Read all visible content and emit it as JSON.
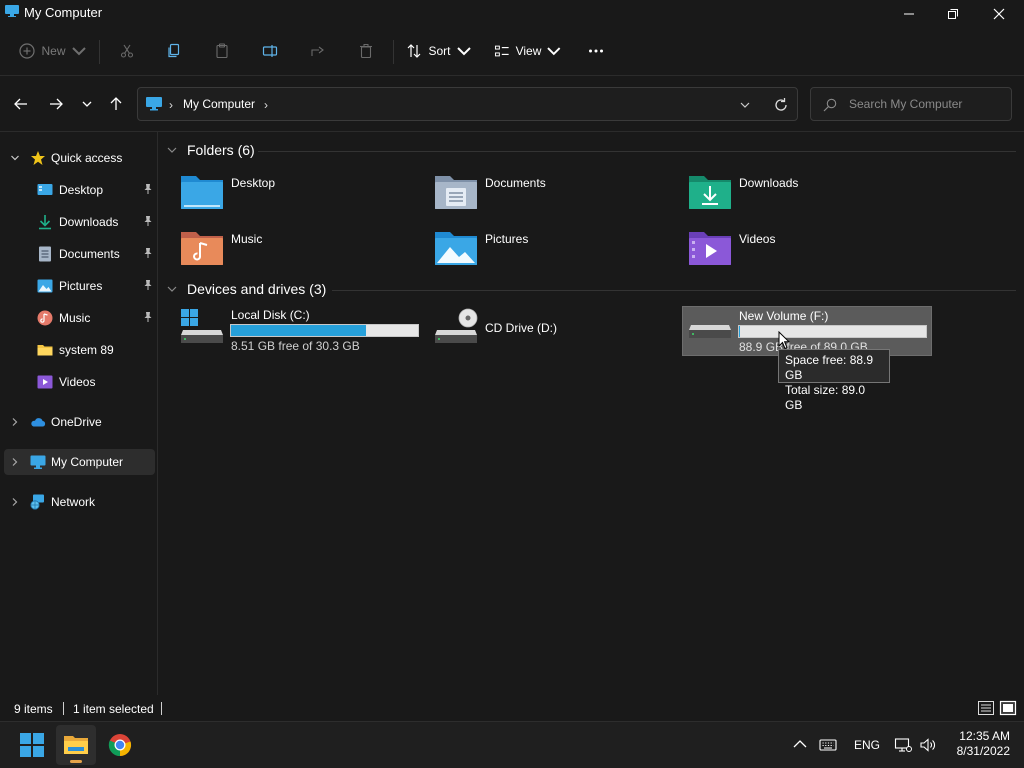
{
  "window": {
    "title": "My Computer"
  },
  "command_bar": {
    "new_label": "New",
    "sort_label": "Sort",
    "view_label": "View"
  },
  "address": {
    "crumb": "My Computer",
    "separator": "›"
  },
  "search": {
    "placeholder": "Search My Computer"
  },
  "sidebar": {
    "items": [
      {
        "label": "Quick access"
      },
      {
        "label": "Desktop"
      },
      {
        "label": "Downloads"
      },
      {
        "label": "Documents"
      },
      {
        "label": "Pictures"
      },
      {
        "label": "Music"
      },
      {
        "label": "system 89"
      },
      {
        "label": "Videos"
      },
      {
        "label": "OneDrive"
      },
      {
        "label": "My Computer"
      },
      {
        "label": "Network"
      }
    ]
  },
  "main": {
    "folders_header": "Folders (6)",
    "folders": [
      {
        "name": "Desktop"
      },
      {
        "name": "Documents"
      },
      {
        "name": "Downloads"
      },
      {
        "name": "Music"
      },
      {
        "name": "Pictures"
      },
      {
        "name": "Videos"
      }
    ],
    "drives_header": "Devices and drives (3)",
    "drives": [
      {
        "name": "Local Disk (C:)",
        "free_text": "8.51 GB free of 30.3 GB",
        "used_fraction": 0.72
      },
      {
        "name": "CD Drive (D:)"
      },
      {
        "name": "New Volume (F:)",
        "free_text": "88.9 GB free of 89.0 GB",
        "used_fraction": 0.001
      }
    ],
    "tooltip": {
      "line1": "Space free: 88.9 GB",
      "line2": "Total size: 89.0 GB"
    }
  },
  "status": {
    "items": "9 items",
    "selected": "1 item selected"
  },
  "taskbar": {
    "language": "ENG",
    "time": "12:35 AM",
    "date": "8/31/2022"
  },
  "colors": {
    "accent": "#26a0da",
    "background": "#191919",
    "folder_blue": "#3aa7e6",
    "folder_green": "#1fb08a",
    "folder_purple": "#8b58d8",
    "folder_orange": "#e88a5a"
  }
}
